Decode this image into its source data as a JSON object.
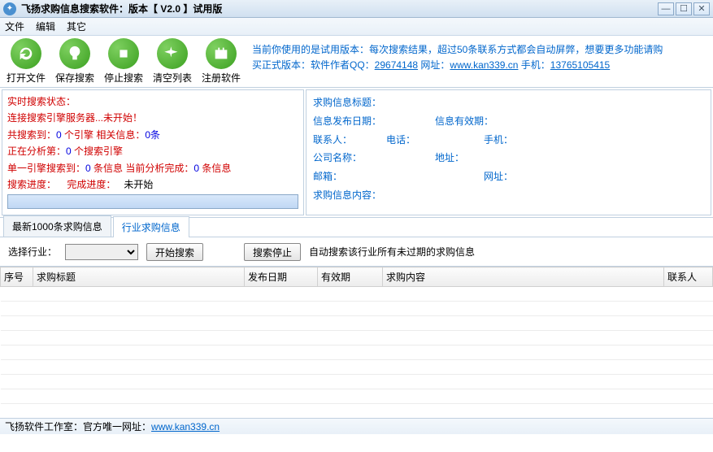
{
  "title": "飞扬求购信息搜索软件：版本【 V2.0 】试用版",
  "menu": {
    "file": "文件",
    "edit": "编辑",
    "other": "其它"
  },
  "toolbar": {
    "open": "打开文件",
    "save": "保存搜索",
    "stop": "停止搜索",
    "clear": "清空列表",
    "register": "注册软件"
  },
  "notice": {
    "line1_a": "当前你使用的是试用版本：每次搜索结果，超过50条联系方式都会自动屏弊，想要更多功能请购",
    "line2_a": "买正式版本：软件作者QQ：",
    "qq": "29674148",
    "line2_b": " 网址：",
    "url": "www.kan339.cn",
    "line2_c": " 手机：",
    "phone": "13765105415"
  },
  "status": {
    "title": "实时搜索状态：",
    "line2": "连接搜索引擎服务器...未开始！",
    "line3_a": "共搜索到：",
    "line3_v1": "0",
    "line3_b": " 个引擎  相关信息：",
    "line3_v2": "0条",
    "line4_a": "正在分析第：",
    "line4_v": "0",
    "line4_b": " 个搜索引擎",
    "line5_a": "单一引擎搜索到：",
    "line5_v1": "0",
    "line5_b": " 条信息  当前分析完成：",
    "line5_v2": "0",
    "line5_c": " 条信息",
    "line6_a": "搜索进度：",
    "line6_b": "完成进度：",
    "line6_c": "未开始"
  },
  "detail": {
    "info_title": "求购信息标题：",
    "pub_date": "信息发布日期：",
    "valid": "信息有效期：",
    "contact": "联系人：",
    "tel": "电话：",
    "mobile": "手机：",
    "company": "公司名称：",
    "address": "地址：",
    "email": "邮箱：",
    "web": "网址：",
    "content": "求购信息内容："
  },
  "tabs": {
    "latest": "最新1000条求购信息",
    "industry": "行业求购信息"
  },
  "filter": {
    "select_label": "选择行业：",
    "start": "开始搜索",
    "stop": "搜索停止",
    "hint": "自动搜索该行业所有未过期的求购信息"
  },
  "columns": {
    "no": "序号",
    "title": "求购标题",
    "pub": "发布日期",
    "valid": "有效期",
    "content": "求购内容",
    "contact": "联系人"
  },
  "statusbar": {
    "studio": "飞扬软件工作室：",
    "only": "官方唯一网址：",
    "url": "www.kan339.cn"
  }
}
